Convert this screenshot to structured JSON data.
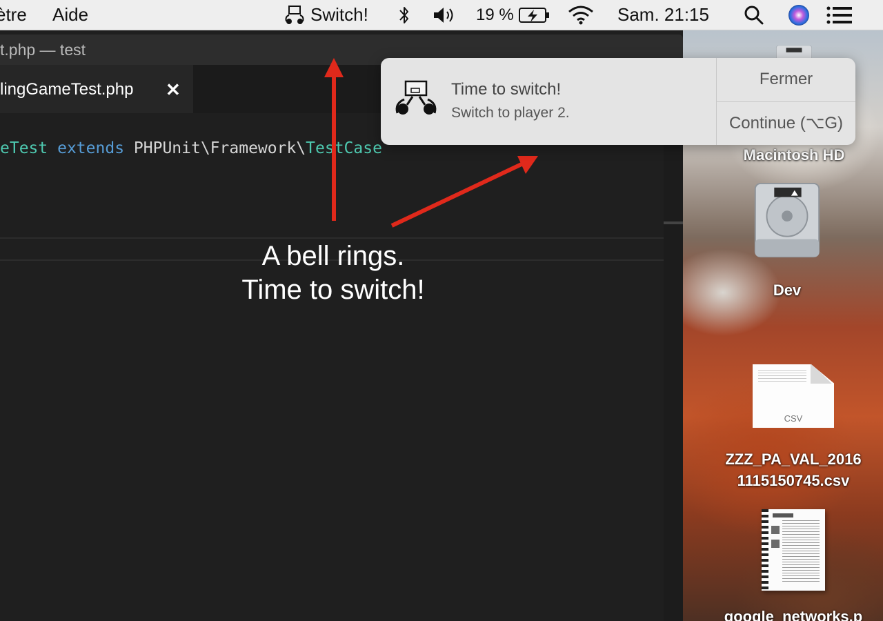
{
  "menubar": {
    "menus": [
      "ètre",
      "Aide"
    ],
    "app_status": "Switch!",
    "battery": "19 %",
    "clock": "Sam. 21:15",
    "status_icons": [
      "switch-app-icon",
      "bluetooth-icon",
      "volume-icon",
      "battery-charging-icon",
      "wifi-icon",
      "search-icon",
      "siri-icon",
      "notification-center-icon"
    ]
  },
  "editor": {
    "window_title": "t.php — test",
    "tab_label": "lingGameTest.php",
    "tab_close": "✕",
    "code": {
      "class_fragment": "eTest",
      "keyword": "extends",
      "namespace_part": "PHPUnit\\Framework\\",
      "parent_class": "TestCase"
    }
  },
  "annotation": {
    "line1": "A bell rings.",
    "line2": "Time to switch!",
    "arrow_color": "#e0291b"
  },
  "notification": {
    "title": "Time to switch!",
    "body": "Switch to player 2.",
    "close_button": "Fermer",
    "action_button": "Continue (⌥G)"
  },
  "desktop": {
    "hd_label": "Macintosh HD",
    "dev_label": "Dev",
    "csv_ext": "CSV",
    "csv_label_line1": "ZZZ_PA_VAL_2016",
    "csv_label_line2": "1115150745.csv",
    "pdf_label": "google_networks.p"
  }
}
